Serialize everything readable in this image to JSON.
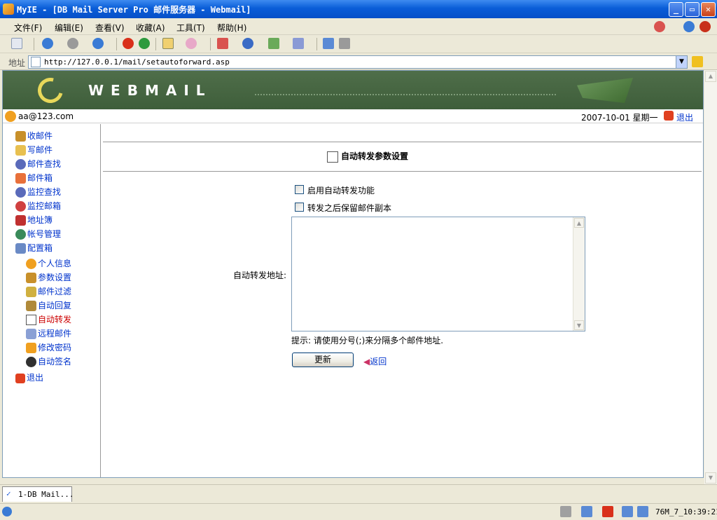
{
  "window": {
    "title": "MyIE - [DB Mail Server Pro 邮件服务器 - Webmail]"
  },
  "menu": [
    "文件(F)",
    "编辑(E)",
    "查看(V)",
    "收藏(A)",
    "工具(T)",
    "帮助(H)"
  ],
  "address": {
    "label": "地址",
    "url": "http://127.0.0.1/mail/setautoforward.asp"
  },
  "banner": {
    "wordmark": "WEBMAIL"
  },
  "user": {
    "email": "aa@123.com",
    "date": "2007-10-01 星期一",
    "logout": "退出"
  },
  "nav": {
    "inbox": "收邮件",
    "compose": "写邮件",
    "search": "邮件查找",
    "mailbox": "邮件箱",
    "monitor_search": "监控查找",
    "monitor_mailbox": "监控邮箱",
    "addressbook": "地址簿",
    "account": "帐号管理",
    "config": "配置箱",
    "personal": "个人信息",
    "params": "参数设置",
    "filter": "邮件过滤",
    "autoreply": "自动回复",
    "autoforward": "自动转发",
    "remote": "远程邮件",
    "password": "修改密码",
    "signature": "自动签名",
    "logout": "退出"
  },
  "form": {
    "title": "自动转发参数设置",
    "enable_label": "启用自动转发功能",
    "enable_checked": false,
    "keep_copy_label": "转发之后保留邮件副本",
    "keep_copy_checked": false,
    "address_label": "自动转发地址:",
    "address_value": "",
    "hint": "提示: 请使用分号(;)来分隔多个邮件地址.",
    "update_button": "更新",
    "back_link": "返回"
  },
  "tab": {
    "label": "1-DB Mail..."
  },
  "status": {
    "text": "76M_7_10:39:21"
  },
  "colors": {
    "banner": "#3E5E3A",
    "link": "#0033CC",
    "active": "#CC0000",
    "titlebar": "#0A5DD8"
  }
}
